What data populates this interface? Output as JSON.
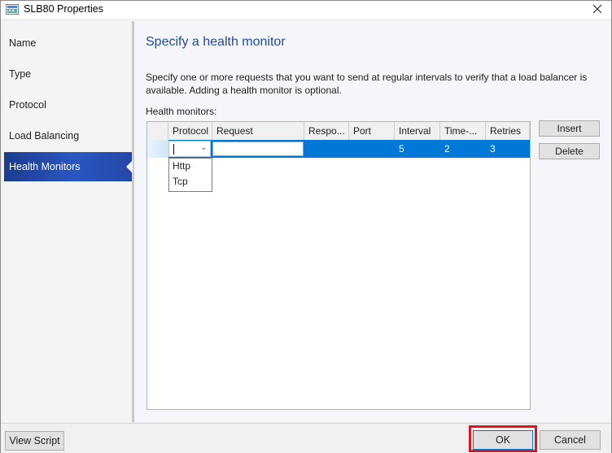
{
  "window": {
    "title": "SLB80 Properties",
    "icon": "app-window-icon",
    "close_icon": "close-icon"
  },
  "sidebar": {
    "items": [
      {
        "label": "Name",
        "active": false
      },
      {
        "label": "Type",
        "active": false
      },
      {
        "label": "Protocol",
        "active": false
      },
      {
        "label": "Load Balancing",
        "active": false
      },
      {
        "label": "Health Monitors",
        "active": true
      }
    ]
  },
  "main": {
    "heading": "Specify a health monitor",
    "description": "Specify one or more requests that you want to send at regular intervals to verify that a load balancer is available. Adding a health monitor is optional.",
    "grid_label": "Health monitors:",
    "grid": {
      "columns": [
        "Protocol",
        "Request",
        "Respo...",
        "Port",
        "Interval",
        "Time-...",
        "Retries"
      ],
      "rows": [
        {
          "protocol": "",
          "request": "",
          "response": "",
          "port": "",
          "interval": "5",
          "timeout": "2",
          "retries": "3",
          "selected": true
        }
      ],
      "protocol_dropdown_options": [
        "Http",
        "Tcp"
      ]
    },
    "insert_label": "Insert",
    "delete_label": "Delete"
  },
  "footer": {
    "view_script_label": "View Script",
    "ok_label": "OK",
    "cancel_label": "Cancel",
    "highlight_color": "#e0141e"
  },
  "colors": {
    "accent": "#0078d7",
    "heading": "#1f4aa8",
    "nav_active": "#2347a8"
  }
}
